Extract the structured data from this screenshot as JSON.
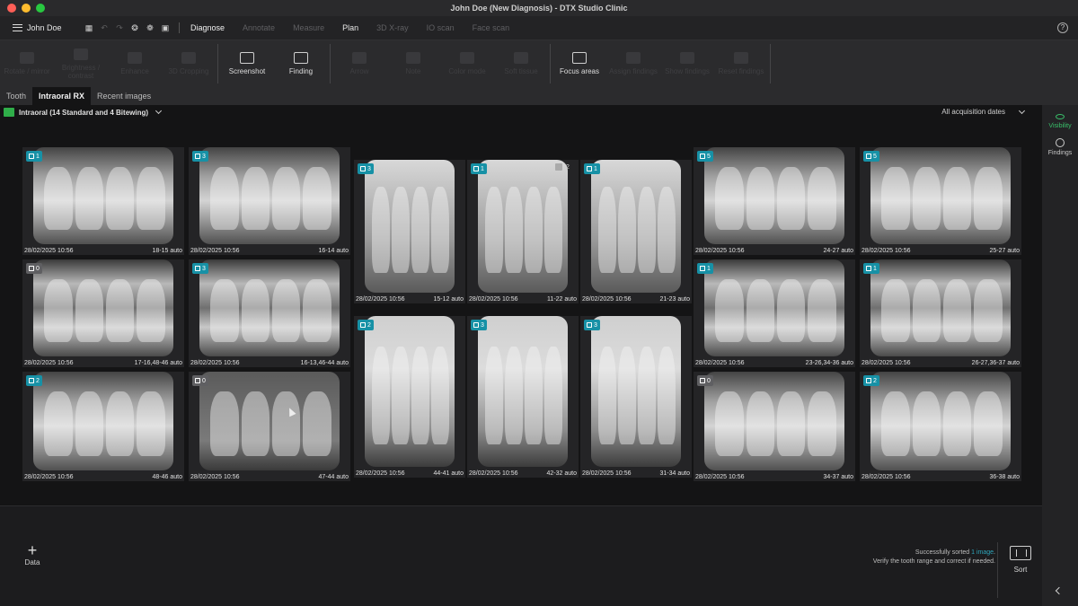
{
  "window": {
    "title": "John Doe (New Diagnosis) - DTX Studio Clinic"
  },
  "menu": {
    "user": "John Doe",
    "tabs": [
      {
        "label": "Diagnose",
        "state": "active"
      },
      {
        "label": "Annotate",
        "state": "disabled"
      },
      {
        "label": "Measure",
        "state": "disabled"
      },
      {
        "label": "Plan",
        "state": "on"
      },
      {
        "label": "3D X-ray",
        "state": "disabled"
      },
      {
        "label": "IO scan",
        "state": "disabled"
      },
      {
        "label": "Face scan",
        "state": "disabled"
      }
    ],
    "help_icon": "help-icon"
  },
  "ribbon": {
    "tools": [
      {
        "label": "Rotate / mirror",
        "enabled": false
      },
      {
        "label": "Brightness / contrast",
        "enabled": false
      },
      {
        "label": "Enhance",
        "enabled": false
      },
      {
        "label": "3D Cropping",
        "enabled": false
      },
      {
        "label": "Screenshot",
        "enabled": true
      },
      {
        "label": "Finding",
        "enabled": true
      },
      {
        "label": "Arrow",
        "enabled": false
      },
      {
        "label": "Note",
        "enabled": false
      },
      {
        "label": "Color mode",
        "enabled": false
      },
      {
        "label": "Soft tissue",
        "enabled": false
      },
      {
        "label": "Focus areas",
        "enabled": true
      },
      {
        "label": "Assign findings",
        "enabled": false
      },
      {
        "label": "Show findings",
        "enabled": false
      },
      {
        "label": "Reset findings",
        "enabled": false
      }
    ]
  },
  "view_tabs": [
    {
      "label": "Tooth",
      "active": false
    },
    {
      "label": "Intraoral RX",
      "active": true
    },
    {
      "label": "Recent images",
      "active": false
    }
  ],
  "filter": {
    "label": "Intraoral (14 Standard and 4 Bitewing)"
  },
  "acquisition": {
    "label": "All acquisition dates"
  },
  "images": [
    {
      "count": "1",
      "badge_color": "#1791a6",
      "date": "28/02/2025 10:56",
      "range": "18-15 auto",
      "shade": "w1"
    },
    {
      "count": "3",
      "badge_color": "#1791a6",
      "date": "28/02/2025 10:56",
      "range": "16-14 auto",
      "shade": "w1"
    },
    {
      "count": "3",
      "badge_color": "#1791a6",
      "date": "28/02/2025 10:56",
      "range": "15-12 auto",
      "shade": "w3"
    },
    {
      "count": "1",
      "badge_color": "#1791a6",
      "date": "28/02/2025 10:56",
      "range": "11-22 auto",
      "shade": "w3",
      "layers": "2"
    },
    {
      "count": "1",
      "badge_color": "#1791a6",
      "date": "28/02/2025 10:56",
      "range": "21-23 auto",
      "shade": "w3"
    },
    {
      "count": "5",
      "badge_color": "#1791a6",
      "date": "28/02/2025 10:56",
      "range": "24-27 auto",
      "shade": "w1"
    },
    {
      "count": "5",
      "badge_color": "#1791a6",
      "date": "28/02/2025 10:56",
      "range": "25-27 auto",
      "shade": "w1"
    },
    {
      "count": "0",
      "badge_color": "#5f5f62",
      "date": "28/02/2025 10:56",
      "range": "17-16,48-46 auto",
      "shade": "w2"
    },
    {
      "count": "3",
      "badge_color": "#1791a6",
      "date": "28/02/2025 10:56",
      "range": "16-13,46-44 auto",
      "shade": "w2"
    },
    {
      "count": "1",
      "badge_color": "#1791a6",
      "date": "28/02/2025 10:56",
      "range": "23-26,34-36 auto",
      "shade": "w2"
    },
    {
      "count": "1",
      "badge_color": "#1791a6",
      "date": "28/02/2025 10:56",
      "range": "26-27,36-37 auto",
      "shade": "w2"
    },
    {
      "count": "2",
      "badge_color": "#1791a6",
      "date": "28/02/2025 10:56",
      "range": "44-41 auto",
      "shade": "w5"
    },
    {
      "count": "3",
      "badge_color": "#1791a6",
      "date": "28/02/2025 10:56",
      "range": "42-32 auto",
      "shade": "w5"
    },
    {
      "count": "3",
      "badge_color": "#1791a6",
      "date": "28/02/2025 10:56",
      "range": "31-34 auto",
      "shade": "w5"
    },
    {
      "count": "2",
      "badge_color": "#1791a6",
      "date": "28/02/2025 10:56",
      "range": "48-46 auto",
      "shade": "w1"
    },
    {
      "count": "0",
      "badge_color": "#5f5f62",
      "date": "28/02/2025 10:56",
      "range": "47-44 auto",
      "shade": "w4"
    },
    {
      "count": "0",
      "badge_color": "#5f5f62",
      "date": "28/02/2025 10:56",
      "range": "34-37 auto",
      "shade": "w1"
    },
    {
      "count": "2",
      "badge_color": "#1791a6",
      "date": "28/02/2025 10:56",
      "range": "36-38 auto",
      "shade": "w1"
    }
  ],
  "right_panel": {
    "visibility": "Visibility",
    "findings": "Findings"
  },
  "bottom": {
    "add_data": "Data",
    "status_prefix": "Successfully sorted ",
    "status_count": "1 image",
    "status_suffix": ".",
    "status_line2": "Verify the tooth range and correct if needed.",
    "sort": "Sort"
  }
}
